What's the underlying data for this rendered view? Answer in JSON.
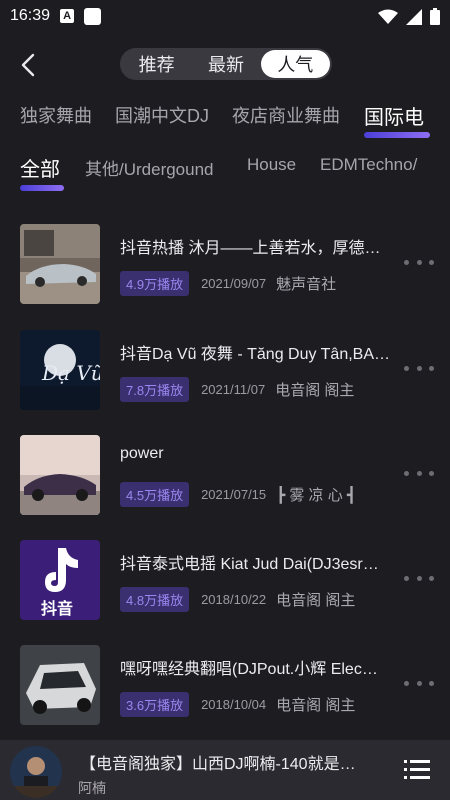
{
  "status_bar": {
    "time": "16:39",
    "notification_letter": "A"
  },
  "header": {
    "segments": [
      {
        "label": "推荐",
        "active": false
      },
      {
        "label": "最新",
        "active": false
      },
      {
        "label": "人气",
        "active": true
      }
    ]
  },
  "categories": [
    {
      "label": "独家舞曲",
      "active": false
    },
    {
      "label": "国潮中文DJ",
      "active": false
    },
    {
      "label": "夜店商业舞曲",
      "active": false
    },
    {
      "label": "国际电",
      "active": true
    }
  ],
  "subcategories": [
    {
      "label": "全部",
      "active": true
    },
    {
      "label": "其他/Urdergound",
      "active": false
    },
    {
      "label": "House",
      "active": false
    },
    {
      "label": "EDMTechno/",
      "active": false
    }
  ],
  "tracks": [
    {
      "title": "抖音热播 沐月——上善若水，厚德…",
      "plays": "4.9万播放",
      "date": "2021/09/07",
      "author": "魅声音社",
      "thumb_icon": "car-cover-image"
    },
    {
      "title": "抖音Dạ Vũ 夜舞 - Tăng Duy Tân,BA…",
      "plays": "7.8万播放",
      "date": "2021/11/07",
      "author": "电音阁 阁主",
      "thumb_icon": "da-vu-cover-image"
    },
    {
      "title": "power",
      "plays": "4.5万播放",
      "date": "2021/07/15",
      "author": "┣ 雾 凉 心 ┫",
      "thumb_icon": "bmw-cover-image"
    },
    {
      "title": "抖音泰式电摇 Kiat Jud Dai(DJ3esr…",
      "plays": "4.8万播放",
      "date": "2018/10/22",
      "author": "电音阁 阁主",
      "thumb_icon": "tiktok-cover-image"
    },
    {
      "title": "嘿呀嘿经典翻唱(DJPout.小辉 Elec…",
      "plays": "3.6万播放",
      "date": "2018/10/04",
      "author": "电音阁 阁主",
      "thumb_icon": "supercar-cover-image"
    }
  ],
  "player": {
    "title": "【电音阁独家】山西DJ啊楠-140就是…",
    "artist": "阿楠"
  },
  "colors": {
    "background": "#1d1c21",
    "accent": "#6d55e8",
    "badge_bg": "#3a2f6f",
    "badge_text": "#9a87f0"
  }
}
